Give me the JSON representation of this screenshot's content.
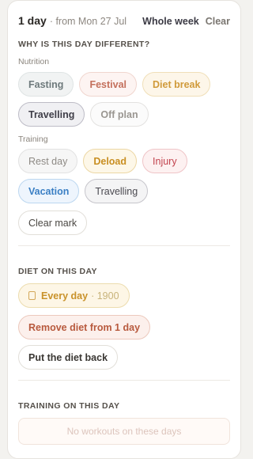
{
  "header": {
    "day_count": "1 day",
    "from_text": "· from Mon 27 Jul",
    "whole_week": "Whole week",
    "clear": "Clear"
  },
  "why": {
    "title": "WHY IS THIS DAY DIFFERENT?",
    "nutrition_label": "Nutrition",
    "nutrition": [
      "Fasting",
      "Festival",
      "Diet break",
      "Travelling",
      "Off plan"
    ],
    "training_label": "Training",
    "training": [
      "Rest day",
      "Deload",
      "Injury",
      "Vacation",
      "Travelling"
    ],
    "clear_mark": "Clear mark"
  },
  "diet": {
    "title": "DIET ON THIS DAY",
    "every_day": "Every day",
    "calories": "· 1900",
    "remove": "Remove diet from 1 day",
    "put_back": "Put the diet back"
  },
  "training": {
    "title": "TRAINING ON THIS DAY",
    "empty": "No workouts on these days"
  },
  "colors": {
    "festival": "#c4705c",
    "diet_break": "#d09a3a",
    "injury": "#c2434e",
    "vacation": "#3a7fc4"
  }
}
